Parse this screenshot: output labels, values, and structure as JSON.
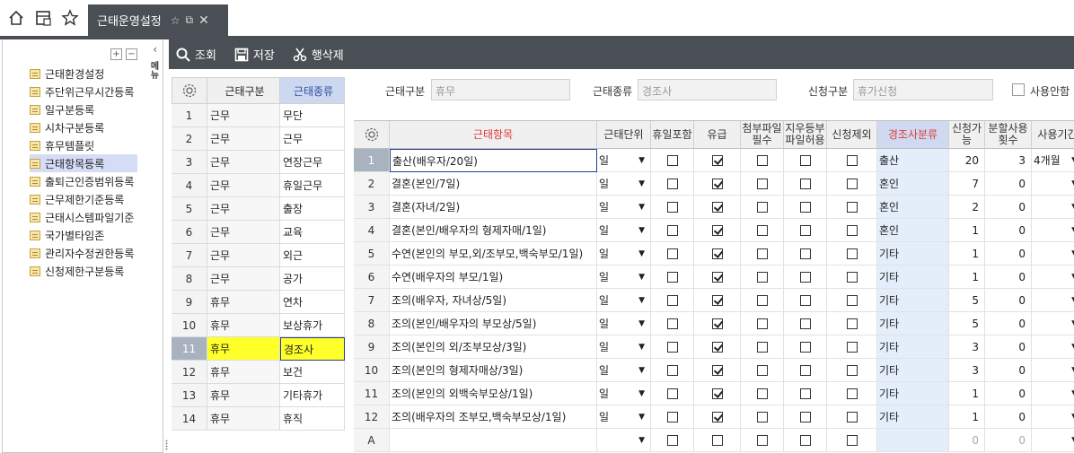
{
  "topbar": {
    "icons": [
      "home-icon",
      "layout-icon",
      "star-icon"
    ],
    "active_tab": "근태운영설정"
  },
  "sidebar": {
    "vertical_label": "메뉴",
    "items": [
      {
        "label": "근태환경설정"
      },
      {
        "label": "주단위근무시간등록"
      },
      {
        "label": "일구분등록"
      },
      {
        "label": "시차구분등록"
      },
      {
        "label": "휴무템플릿"
      },
      {
        "label": "근태항목등록",
        "selected": true
      },
      {
        "label": "출퇴근인증범위등록"
      },
      {
        "label": "근무제한기준등록"
      },
      {
        "label": "근태시스템파일기준"
      },
      {
        "label": "국가별타임존"
      },
      {
        "label": "관리자수정권한등록"
      },
      {
        "label": "신청제한구분등록"
      }
    ]
  },
  "toolbar": {
    "search_label": "조회",
    "save_label": "저장",
    "delete_label": "행삭제"
  },
  "category_grid": {
    "headers": {
      "type": "근태구분",
      "kind": "근태종류"
    },
    "rows": [
      {
        "no": "1",
        "type": "근무",
        "kind": "무단"
      },
      {
        "no": "2",
        "type": "근무",
        "kind": "근무"
      },
      {
        "no": "3",
        "type": "근무",
        "kind": "연장근무"
      },
      {
        "no": "4",
        "type": "근무",
        "kind": "휴일근무"
      },
      {
        "no": "5",
        "type": "근무",
        "kind": "출장"
      },
      {
        "no": "6",
        "type": "근무",
        "kind": "교육"
      },
      {
        "no": "7",
        "type": "근무",
        "kind": "외근"
      },
      {
        "no": "8",
        "type": "근무",
        "kind": "공가"
      },
      {
        "no": "9",
        "type": "휴무",
        "kind": "연차"
      },
      {
        "no": "10",
        "type": "휴무",
        "kind": "보상휴가"
      },
      {
        "no": "11",
        "type": "휴무",
        "kind": "경조사",
        "selected": true
      },
      {
        "no": "12",
        "type": "휴무",
        "kind": "보건"
      },
      {
        "no": "13",
        "type": "휴무",
        "kind": "기타휴가"
      },
      {
        "no": "14",
        "type": "휴무",
        "kind": "휴직"
      }
    ]
  },
  "filter": {
    "type_label": "근태구분",
    "type_value": "휴무",
    "kind_label": "근태종류",
    "kind_value": "경조사",
    "request_label": "신청구분",
    "request_value": "휴가신청",
    "unused_label": "사용안함"
  },
  "detail_grid": {
    "headers": {
      "item": "근태항목",
      "unit": "근태단위",
      "holiday": "휴일포함",
      "paid": "유급",
      "attach_required": "첨부파일필수",
      "attach_allowed": "지우등부파일허용",
      "request_exclude": "신청제외",
      "category": "경조사분류",
      "request_days": "신청가능",
      "split_count": "분할사용횟수",
      "use_period": "사용기간"
    },
    "rows": [
      {
        "no": "1",
        "item": "출산(배우자/20일)",
        "unit": "일",
        "holiday": false,
        "paid": true,
        "attach_required": false,
        "attach_allowed": false,
        "request_exclude": false,
        "category": "출산",
        "request_days": "20",
        "split_count": "3",
        "use_period": "4개월"
      },
      {
        "no": "2",
        "item": "결혼(본인/7일)",
        "unit": "일",
        "holiday": false,
        "paid": true,
        "attach_required": false,
        "attach_allowed": false,
        "request_exclude": false,
        "category": "혼인",
        "request_days": "7",
        "split_count": "0",
        "use_period": ""
      },
      {
        "no": "3",
        "item": "결혼(자녀/2일)",
        "unit": "일",
        "holiday": false,
        "paid": true,
        "attach_required": false,
        "attach_allowed": false,
        "request_exclude": false,
        "category": "혼인",
        "request_days": "2",
        "split_count": "0",
        "use_period": ""
      },
      {
        "no": "4",
        "item": "결혼(본인/배우자의 형제자매/1일)",
        "unit": "일",
        "holiday": false,
        "paid": true,
        "attach_required": false,
        "attach_allowed": false,
        "request_exclude": false,
        "category": "혼인",
        "request_days": "1",
        "split_count": "0",
        "use_period": ""
      },
      {
        "no": "5",
        "item": "수연(본인의 부모,외/조부모,백숙부모/1일)",
        "unit": "일",
        "holiday": false,
        "paid": true,
        "attach_required": false,
        "attach_allowed": false,
        "request_exclude": false,
        "category": "기타",
        "request_days": "1",
        "split_count": "0",
        "use_period": ""
      },
      {
        "no": "6",
        "item": "수연(배우자의 부모/1일)",
        "unit": "일",
        "holiday": false,
        "paid": true,
        "attach_required": false,
        "attach_allowed": false,
        "request_exclude": false,
        "category": "기타",
        "request_days": "1",
        "split_count": "0",
        "use_period": ""
      },
      {
        "no": "7",
        "item": "조의(배우자, 자녀상/5일)",
        "unit": "일",
        "holiday": false,
        "paid": true,
        "attach_required": false,
        "attach_allowed": false,
        "request_exclude": false,
        "category": "기타",
        "request_days": "5",
        "split_count": "0",
        "use_period": ""
      },
      {
        "no": "8",
        "item": "조의(본인/배우자의 부모상/5일)",
        "unit": "일",
        "holiday": false,
        "paid": true,
        "attach_required": false,
        "attach_allowed": false,
        "request_exclude": false,
        "category": "기타",
        "request_days": "5",
        "split_count": "0",
        "use_period": ""
      },
      {
        "no": "9",
        "item": "조의(본인의 외/조부모상/3일)",
        "unit": "일",
        "holiday": false,
        "paid": true,
        "attach_required": false,
        "attach_allowed": false,
        "request_exclude": false,
        "category": "기타",
        "request_days": "3",
        "split_count": "0",
        "use_period": ""
      },
      {
        "no": "10",
        "item": "조의(본인의 형제자매상/3일)",
        "unit": "일",
        "holiday": false,
        "paid": true,
        "attach_required": false,
        "attach_allowed": false,
        "request_exclude": false,
        "category": "기타",
        "request_days": "3",
        "split_count": "0",
        "use_period": ""
      },
      {
        "no": "11",
        "item": "조의(본인의 외백숙부모상/1일)",
        "unit": "일",
        "holiday": false,
        "paid": true,
        "attach_required": false,
        "attach_allowed": false,
        "request_exclude": false,
        "category": "기타",
        "request_days": "1",
        "split_count": "0",
        "use_period": ""
      },
      {
        "no": "12",
        "item": "조의(배우자의 조부모,백숙부모상/1일)",
        "unit": "일",
        "holiday": false,
        "paid": true,
        "attach_required": false,
        "attach_allowed": false,
        "request_exclude": false,
        "category": "기타",
        "request_days": "1",
        "split_count": "0",
        "use_period": ""
      },
      {
        "no": "A",
        "item": "",
        "unit": "",
        "holiday": false,
        "paid": false,
        "attach_required": false,
        "attach_allowed": false,
        "request_exclude": false,
        "category": "",
        "request_days": "0",
        "split_count": "0",
        "use_period": "",
        "new_row": true
      }
    ]
  }
}
